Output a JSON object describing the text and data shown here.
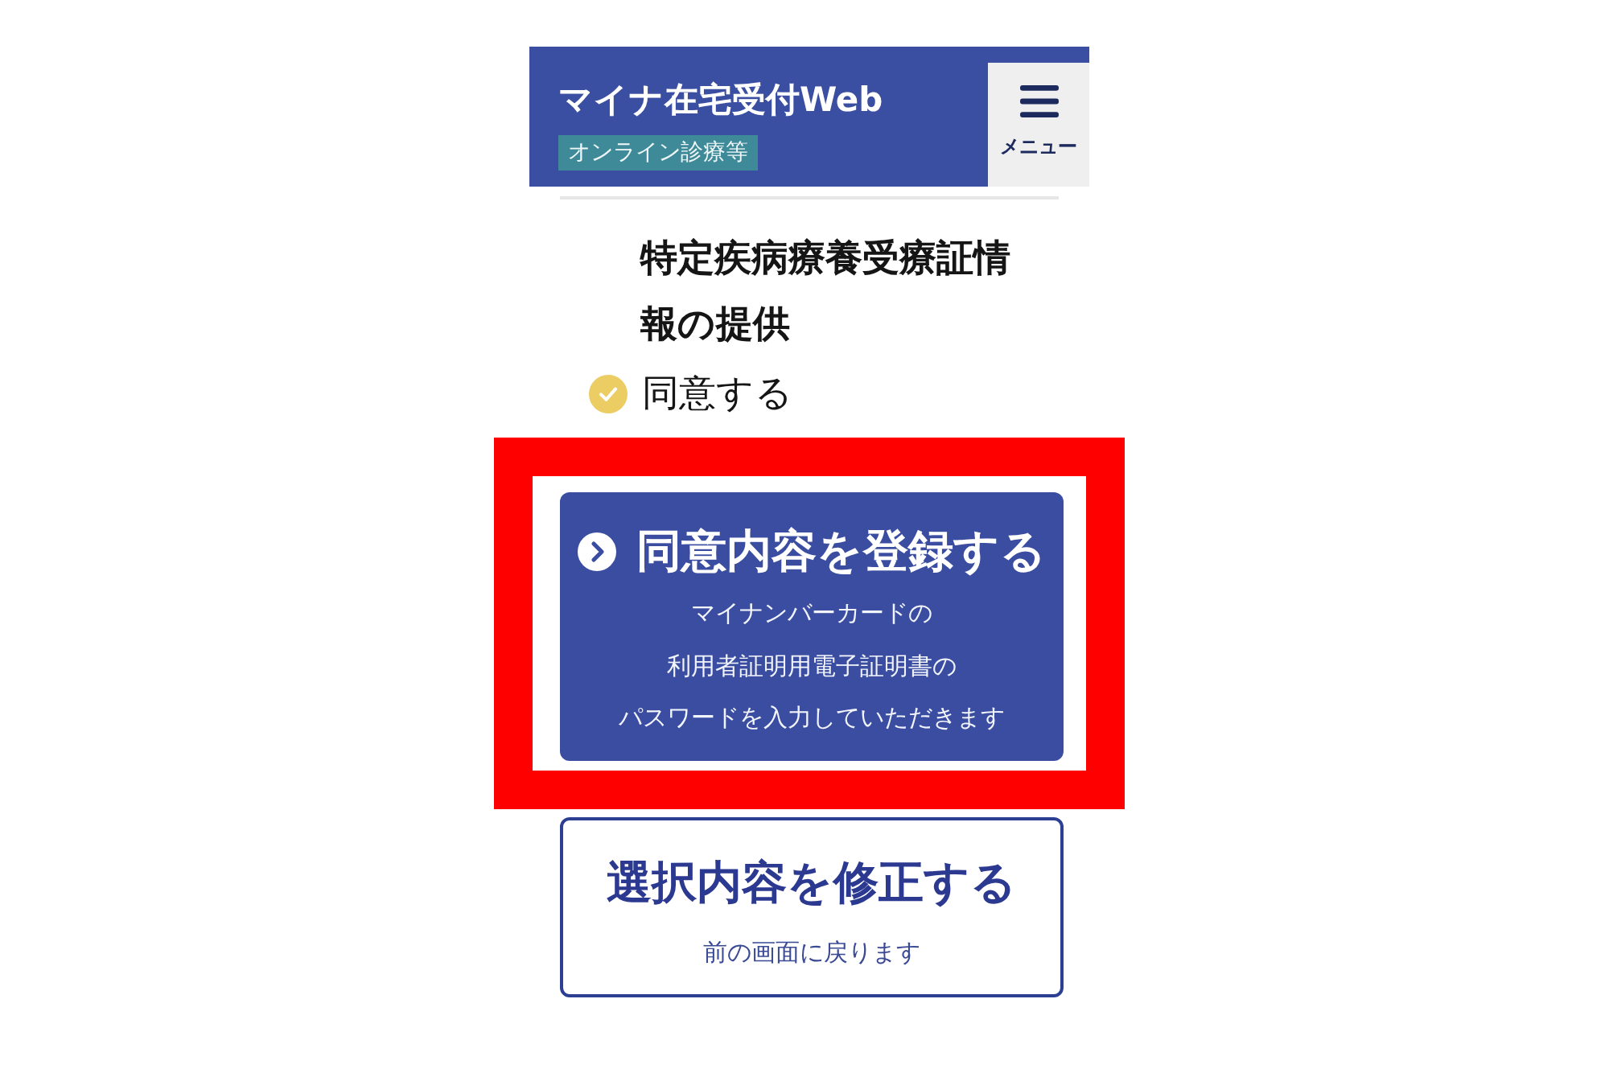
{
  "header": {
    "title": "マイナ在宅受付Web",
    "badge": "オンライン診療等",
    "menu_button": {
      "label": "メニュー"
    }
  },
  "consent_item": {
    "title": "特定疾病療養受療証情報の提供",
    "answer": {
      "label": "同意する",
      "checked": true
    }
  },
  "buttons": [
    {
      "kind": "primary",
      "label": "同意内容を登録する",
      "description_lines": [
        "マイナンバーカードの",
        "利用者証明用電子証明書の",
        "パスワードを入力していただきます"
      ],
      "highlighted": true
    },
    {
      "kind": "secondary",
      "label": "選択内容を修正する",
      "description_lines": [
        "前の画面に戻ります"
      ],
      "highlighted": false
    }
  ]
}
